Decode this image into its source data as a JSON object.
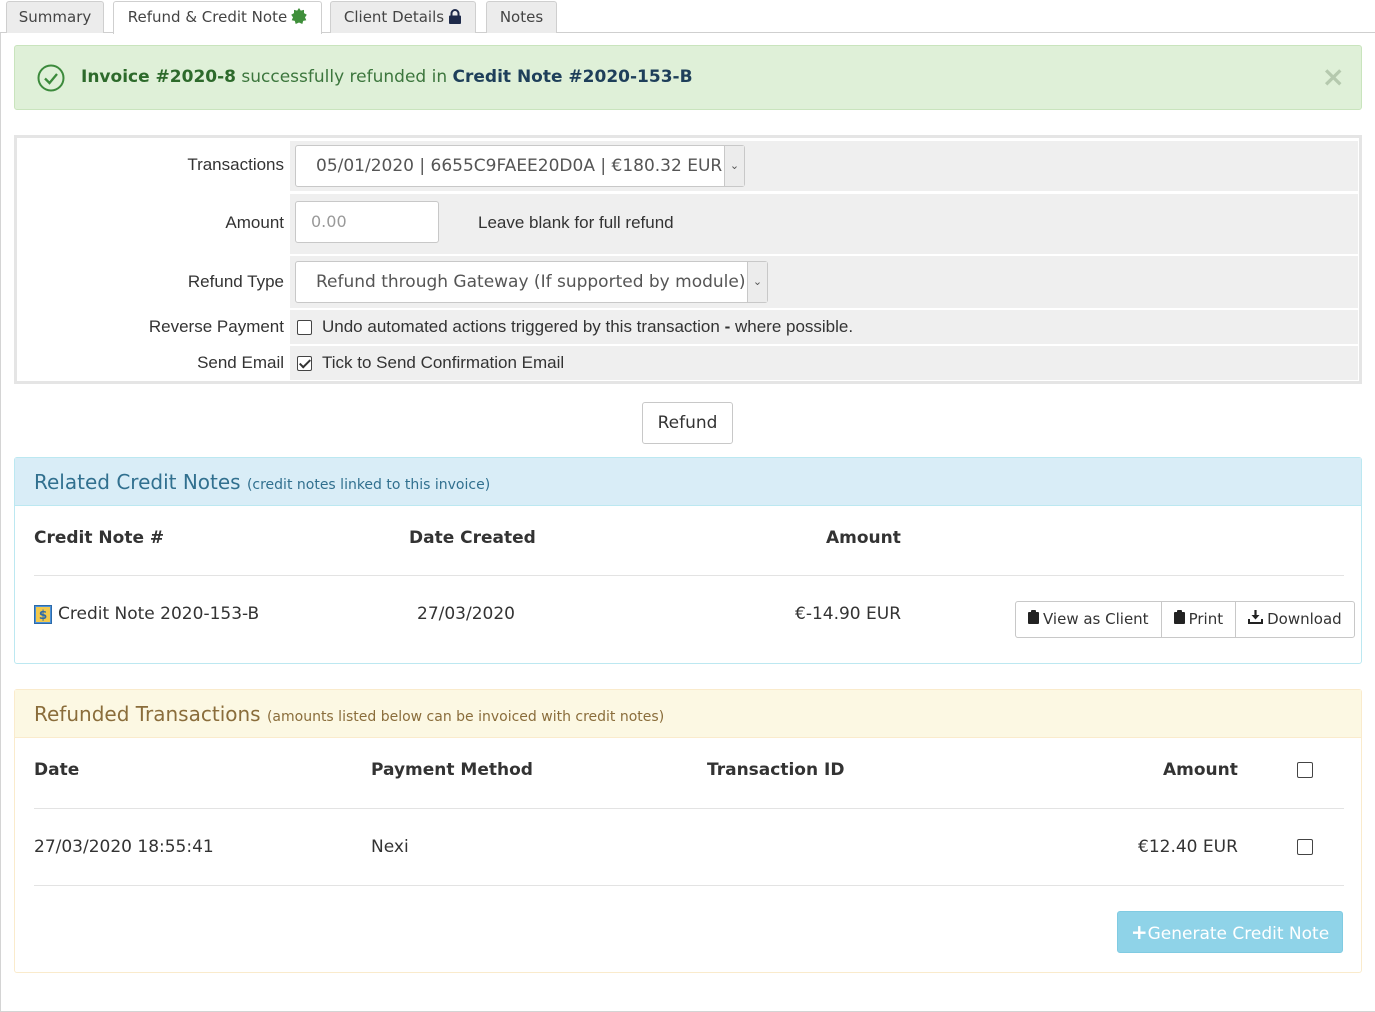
{
  "tabs": [
    {
      "label": "Summary"
    },
    {
      "label": "Refund & Credit Note"
    },
    {
      "label": "Client Details"
    },
    {
      "label": "Notes"
    }
  ],
  "alert": {
    "invoice": "Invoice #2020-8",
    "middle": " successfully refunded in ",
    "credit_note": "Credit Note #2020-153-B",
    "close": "×",
    "color": "#3c763d"
  },
  "form": {
    "transactions_label": "Transactions",
    "transactions_value": "05/01/2020 | 6655C9FAEE20D0A | €180.32 EUR",
    "amount_label": "Amount",
    "amount_placeholder": "0.00",
    "amount_hint": "Leave blank for full refund",
    "refund_type_label": "Refund Type",
    "refund_type_value": "Refund through Gateway (If supported by module)",
    "reverse_payment_label": "Reverse Payment",
    "reverse_payment_text_a": "Undo automated actions triggered by this transaction ",
    "reverse_payment_text_b": "- ",
    "reverse_payment_text_c": "where possible.",
    "reverse_payment_checked": false,
    "send_email_label": "Send Email",
    "send_email_text": "Tick to Send Confirmation Email",
    "send_email_checked": true,
    "refund_button": "Refund"
  },
  "credit_notes": {
    "title": "Related Credit Notes",
    "subtitle": "(credit notes linked to this invoice)",
    "columns": [
      "Credit Note #",
      "Date Created",
      "Amount"
    ],
    "rows": [
      {
        "name": "Credit Note 2020-153-B",
        "date": "27/03/2020",
        "amount": "€-14.90 EUR"
      }
    ],
    "actions": {
      "view": "View as Client",
      "print": "Print",
      "download": "Download"
    }
  },
  "refunded": {
    "title": "Refunded Transactions",
    "subtitle": "(amounts listed below can be invoiced with credit notes)",
    "columns": [
      "Date",
      "Payment Method",
      "Transaction ID",
      "Amount"
    ],
    "rows": [
      {
        "date": "27/03/2020 18:55:41",
        "method": "Nexi",
        "transaction_id": "",
        "amount": "€12.40 EUR"
      }
    ],
    "generate_button": "Generate Credit Note",
    "generate_color": "#8fd3e8"
  }
}
